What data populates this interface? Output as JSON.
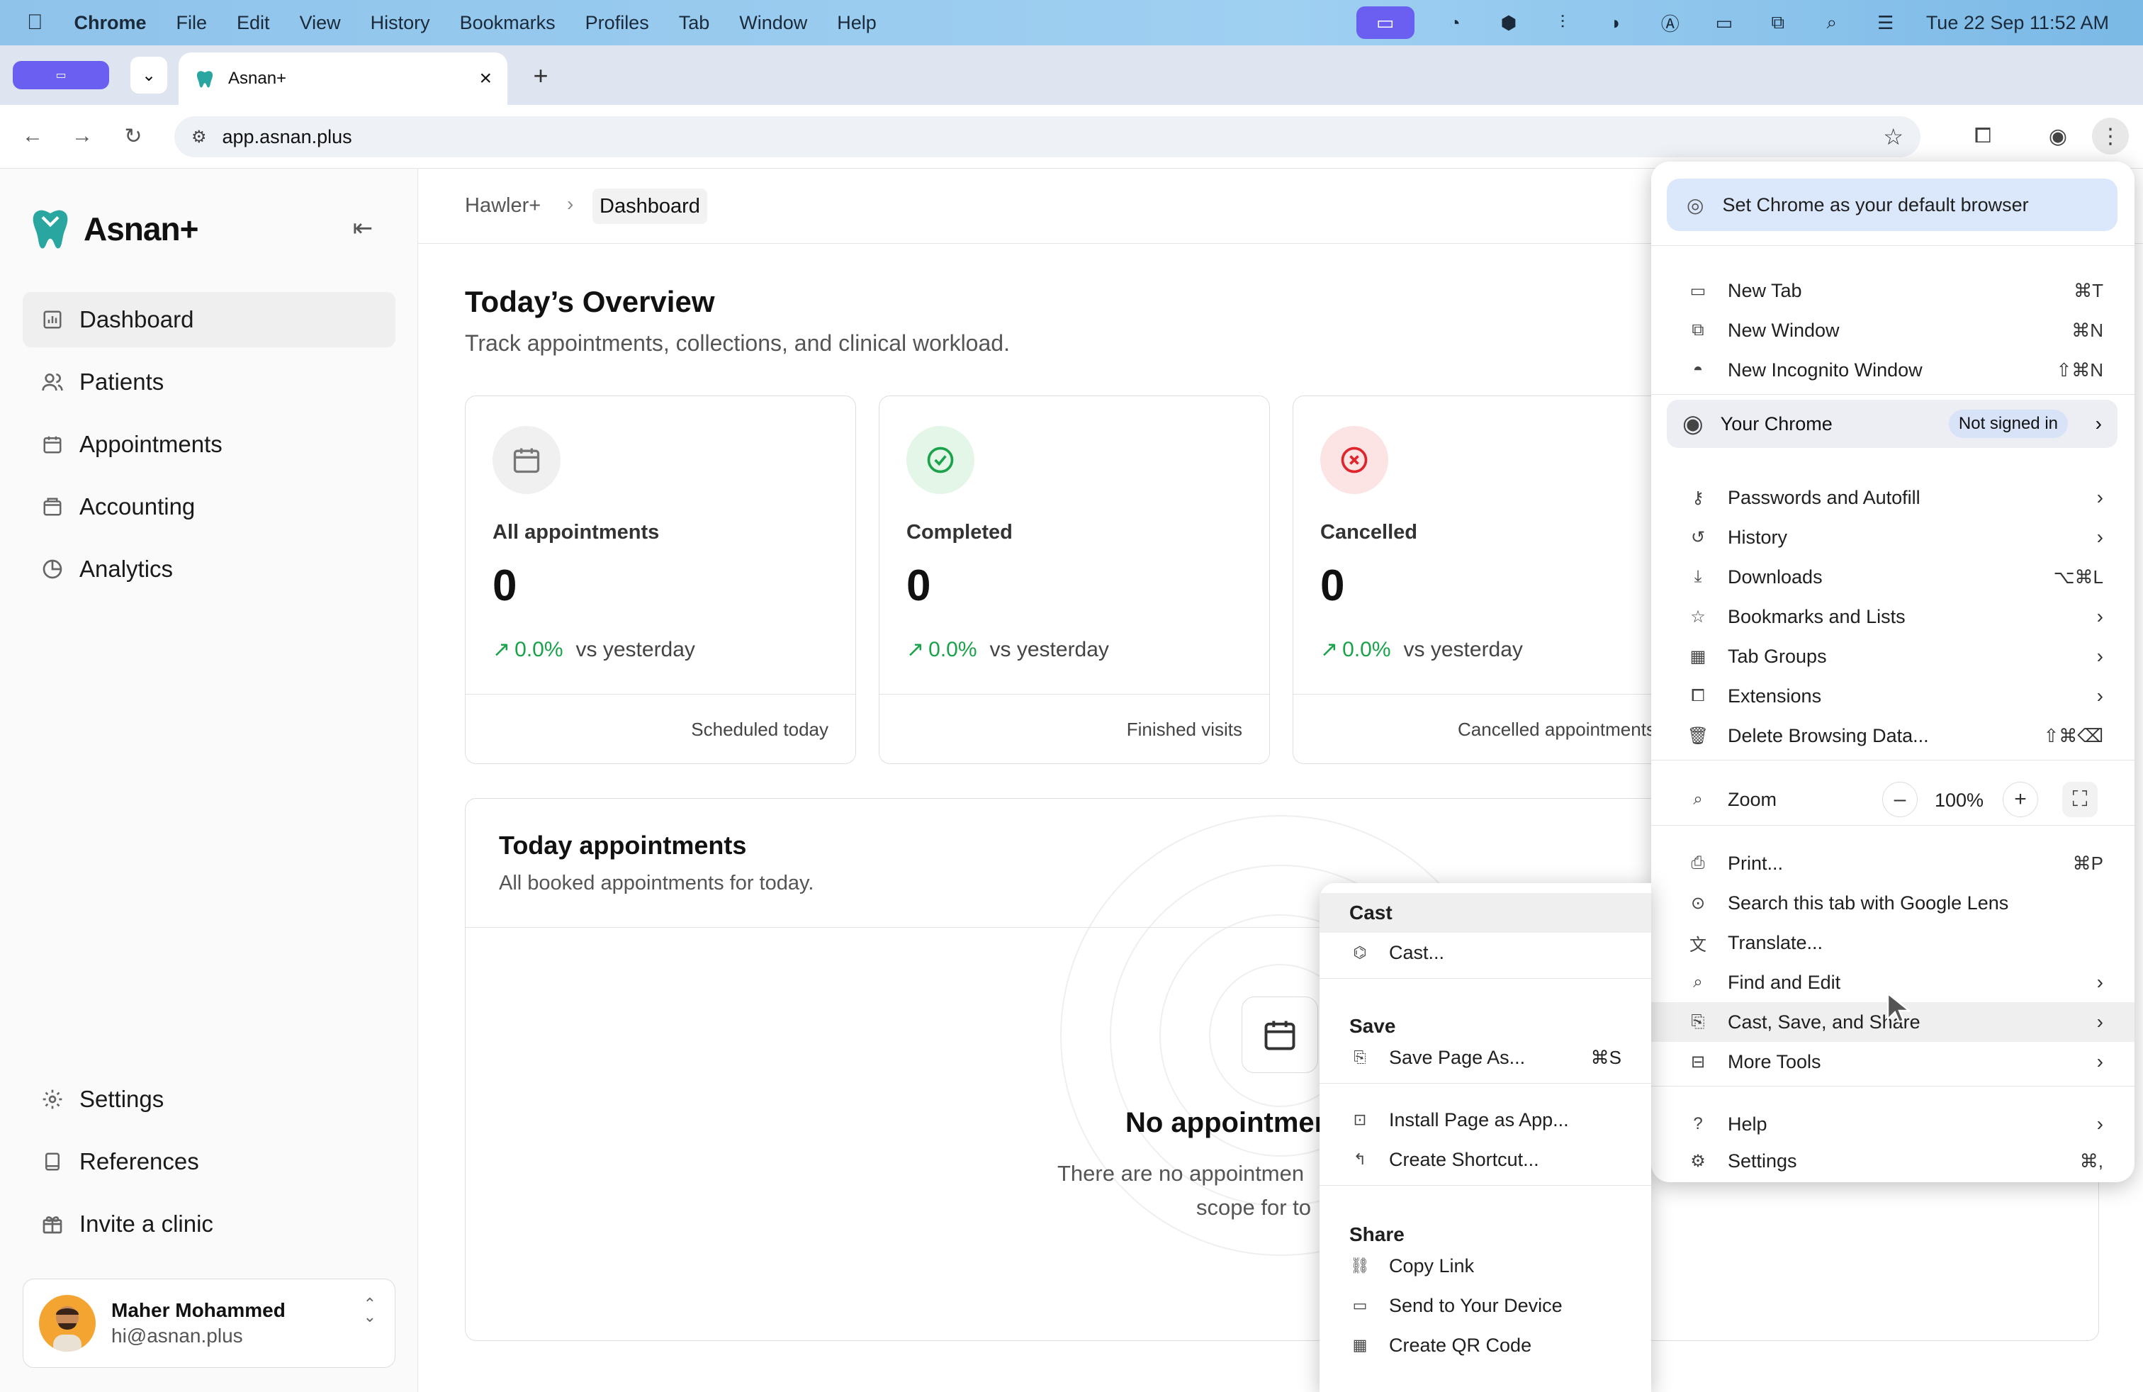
{
  "menubar": {
    "items": [
      "Chrome",
      "File",
      "Edit",
      "View",
      "History",
      "Bookmarks",
      "Profiles",
      "Tab",
      "Window",
      "Help"
    ],
    "datetime": "Tue 22 Sep  11:52 AM"
  },
  "tab": {
    "title": "Asnan+"
  },
  "omnibox": {
    "url": "app.asnan.plus"
  },
  "sidebar": {
    "brand": "Asnan+",
    "nav": [
      {
        "label": "Dashboard",
        "icon": "bar-chart-icon"
      },
      {
        "label": "Patients",
        "icon": "users-icon"
      },
      {
        "label": "Appointments",
        "icon": "calendar-icon"
      },
      {
        "label": "Accounting",
        "icon": "wallet-icon"
      },
      {
        "label": "Analytics",
        "icon": "pie-chart-icon"
      }
    ],
    "bottom": [
      {
        "label": "Settings",
        "icon": "gear-icon"
      },
      {
        "label": "References",
        "icon": "book-icon"
      },
      {
        "label": "Invite a clinic",
        "icon": "gift-icon"
      }
    ],
    "user": {
      "name": "Maher Mohammed",
      "email": "hi@asnan.plus"
    }
  },
  "breadcrumb": {
    "parent": "Hawler+",
    "current": "Dashboard"
  },
  "overview": {
    "title": "Today’s Overview",
    "subtitle": "Track appointments, collections, and clinical workload.",
    "cards": [
      {
        "title": "All appointments",
        "value": "0",
        "pct": "0.0%",
        "vs": "vs yesterday",
        "footer": "Scheduled today",
        "accent": "#888888"
      },
      {
        "title": "Completed",
        "value": "0",
        "pct": "0.0%",
        "vs": "vs yesterday",
        "footer": "Finished visits",
        "accent": "#1aa34a"
      },
      {
        "title": "Cancelled",
        "value": "0",
        "pct": "0.0%",
        "vs": "vs yesterday",
        "footer": "Cancelled appointments",
        "accent": "#e0242c"
      }
    ]
  },
  "appointments": {
    "title": "Today appointments",
    "subtitle": "All booked appointments for today.",
    "empty_title": "No appointmen",
    "empty_desc_1": "There are no appointmen",
    "empty_desc_2": "scope for to"
  },
  "chrome_menu": {
    "default_browser": "Set Chrome as your default browser",
    "new_tab": {
      "label": "New Tab",
      "shortcut": "⌘T"
    },
    "new_window": {
      "label": "New Window",
      "shortcut": "⌘N"
    },
    "new_incognito": {
      "label": "New Incognito Window",
      "shortcut": "⇧⌘N"
    },
    "your_chrome": "Your Chrome",
    "not_signed_in": "Not signed in",
    "passwords": "Passwords and Autofill",
    "history": "History",
    "downloads": {
      "label": "Downloads",
      "shortcut": "⌥⌘L"
    },
    "bookmarks": "Bookmarks and Lists",
    "tab_groups": "Tab Groups",
    "extensions": "Extensions",
    "delete_data": {
      "label": "Delete Browsing Data...",
      "shortcut": "⇧⌘⌫"
    },
    "zoom": {
      "label": "Zoom",
      "value": "100%",
      "minus": "–",
      "plus": "+"
    },
    "print": {
      "label": "Print...",
      "shortcut": "⌘P"
    },
    "lens": "Search this tab with Google Lens",
    "translate": "Translate...",
    "find_edit": "Find and Edit",
    "cast_save_share": "Cast, Save, and Share",
    "more_tools": "More Tools",
    "help": "Help",
    "settings": {
      "label": "Settings",
      "shortcut": "⌘,"
    }
  },
  "submenu": {
    "cast_header": "Cast",
    "cast": "Cast...",
    "save_header": "Save",
    "save_page": {
      "label": "Save Page As...",
      "shortcut": "⌘S"
    },
    "install": "Install Page as App...",
    "shortcut": "Create Shortcut...",
    "share_header": "Share",
    "copy_link": "Copy Link",
    "send_device": "Send to Your Device",
    "qr": "Create QR Code"
  }
}
